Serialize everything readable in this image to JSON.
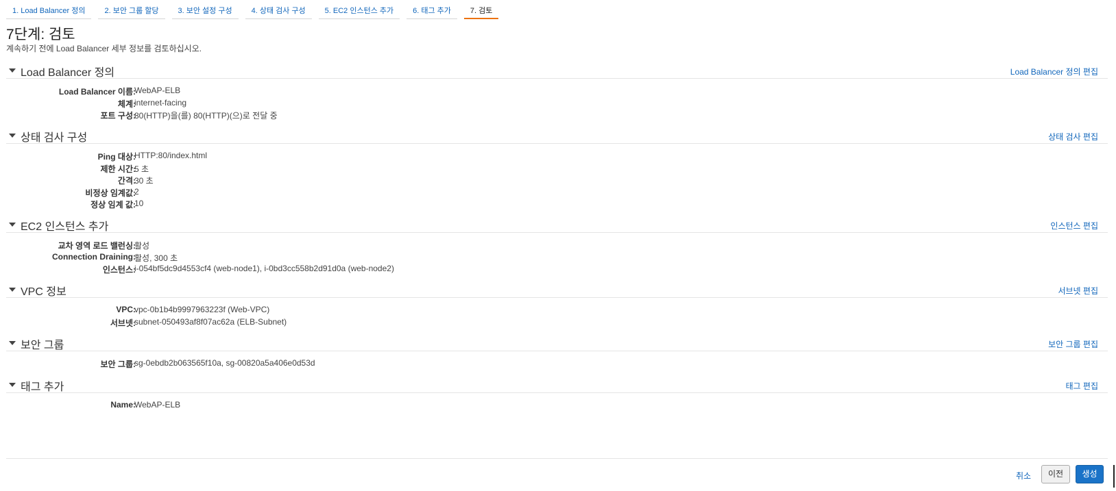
{
  "wizard": {
    "tabs": [
      {
        "label": "1. Load Balancer 정의"
      },
      {
        "label": "2. 보안 그룹 할당"
      },
      {
        "label": "3. 보안 설정 구성"
      },
      {
        "label": "4. 상태 검사 구성"
      },
      {
        "label": "5. EC2 인스턴스 추가"
      },
      {
        "label": "6. 태그 추가"
      },
      {
        "label": "7. 검토"
      }
    ],
    "active_index": 6
  },
  "page": {
    "title": "7단계: 검토",
    "subtitle": "계속하기 전에 Load Balancer 세부 정보를 검토하십시오."
  },
  "sections": [
    {
      "title": "Load Balancer 정의",
      "edit_label": "Load Balancer 정의 편집",
      "rows": [
        {
          "label": "Load Balancer 이름:",
          "value": "WebAP-ELB"
        },
        {
          "label": "체계:",
          "value": "internet-facing"
        },
        {
          "label": "포트 구성:",
          "value": "80(HTTP)을(를) 80(HTTP)(으)로 전달 중"
        }
      ]
    },
    {
      "title": "상태 검사 구성",
      "edit_label": "상태 검사 편집",
      "rows": [
        {
          "label": "Ping 대상:",
          "value": "HTTP:80/index.html"
        },
        {
          "label": "제한 시간:",
          "value": "5 초"
        },
        {
          "label": "간격:",
          "value": "30 초"
        },
        {
          "label": "비정상 임계값:",
          "value": "2"
        },
        {
          "label": "정상 임계 값:",
          "value": "10"
        }
      ]
    },
    {
      "title": "EC2 인스턴스 추가",
      "edit_label": "인스턴스 편집",
      "rows": [
        {
          "label": "교차 영역 로드 밸런싱:",
          "value": "활성"
        },
        {
          "label": "Connection Draining:",
          "value": "활성, 300 초"
        },
        {
          "label": "인스턴스:",
          "value": "i-054bf5dc9d4553cf4 (web-node1), i-0bd3cc558b2d91d0a (web-node2)"
        }
      ]
    },
    {
      "title": "VPC 정보",
      "edit_label": "서브넷 편집",
      "rows": [
        {
          "label": "VPC:",
          "value": "vpc-0b1b4b9997963223f (Web-VPC)"
        },
        {
          "label": "서브넷:",
          "value": "subnet-050493af8f07ac62a (ELB-Subnet)"
        }
      ]
    },
    {
      "title": "보안 그룹",
      "edit_label": "보안 그룹 편집",
      "rows": [
        {
          "label": "보안 그룹:",
          "value": "sg-0ebdb2b063565f10a, sg-00820a5a406e0d53d"
        }
      ]
    },
    {
      "title": "태그 추가",
      "edit_label": "태그 편집",
      "rows": [
        {
          "label": "Name:",
          "value": "WebAP-ELB"
        }
      ]
    }
  ],
  "footer": {
    "cancel_label": "취소",
    "prev_label": "이전",
    "create_label": "생성"
  },
  "colors": {
    "link": "#1166bb",
    "active_tab_underline": "#ec7211",
    "primary_button": "#1a73c8"
  },
  "icons": {
    "section_toggle": "caret-down-icon"
  }
}
